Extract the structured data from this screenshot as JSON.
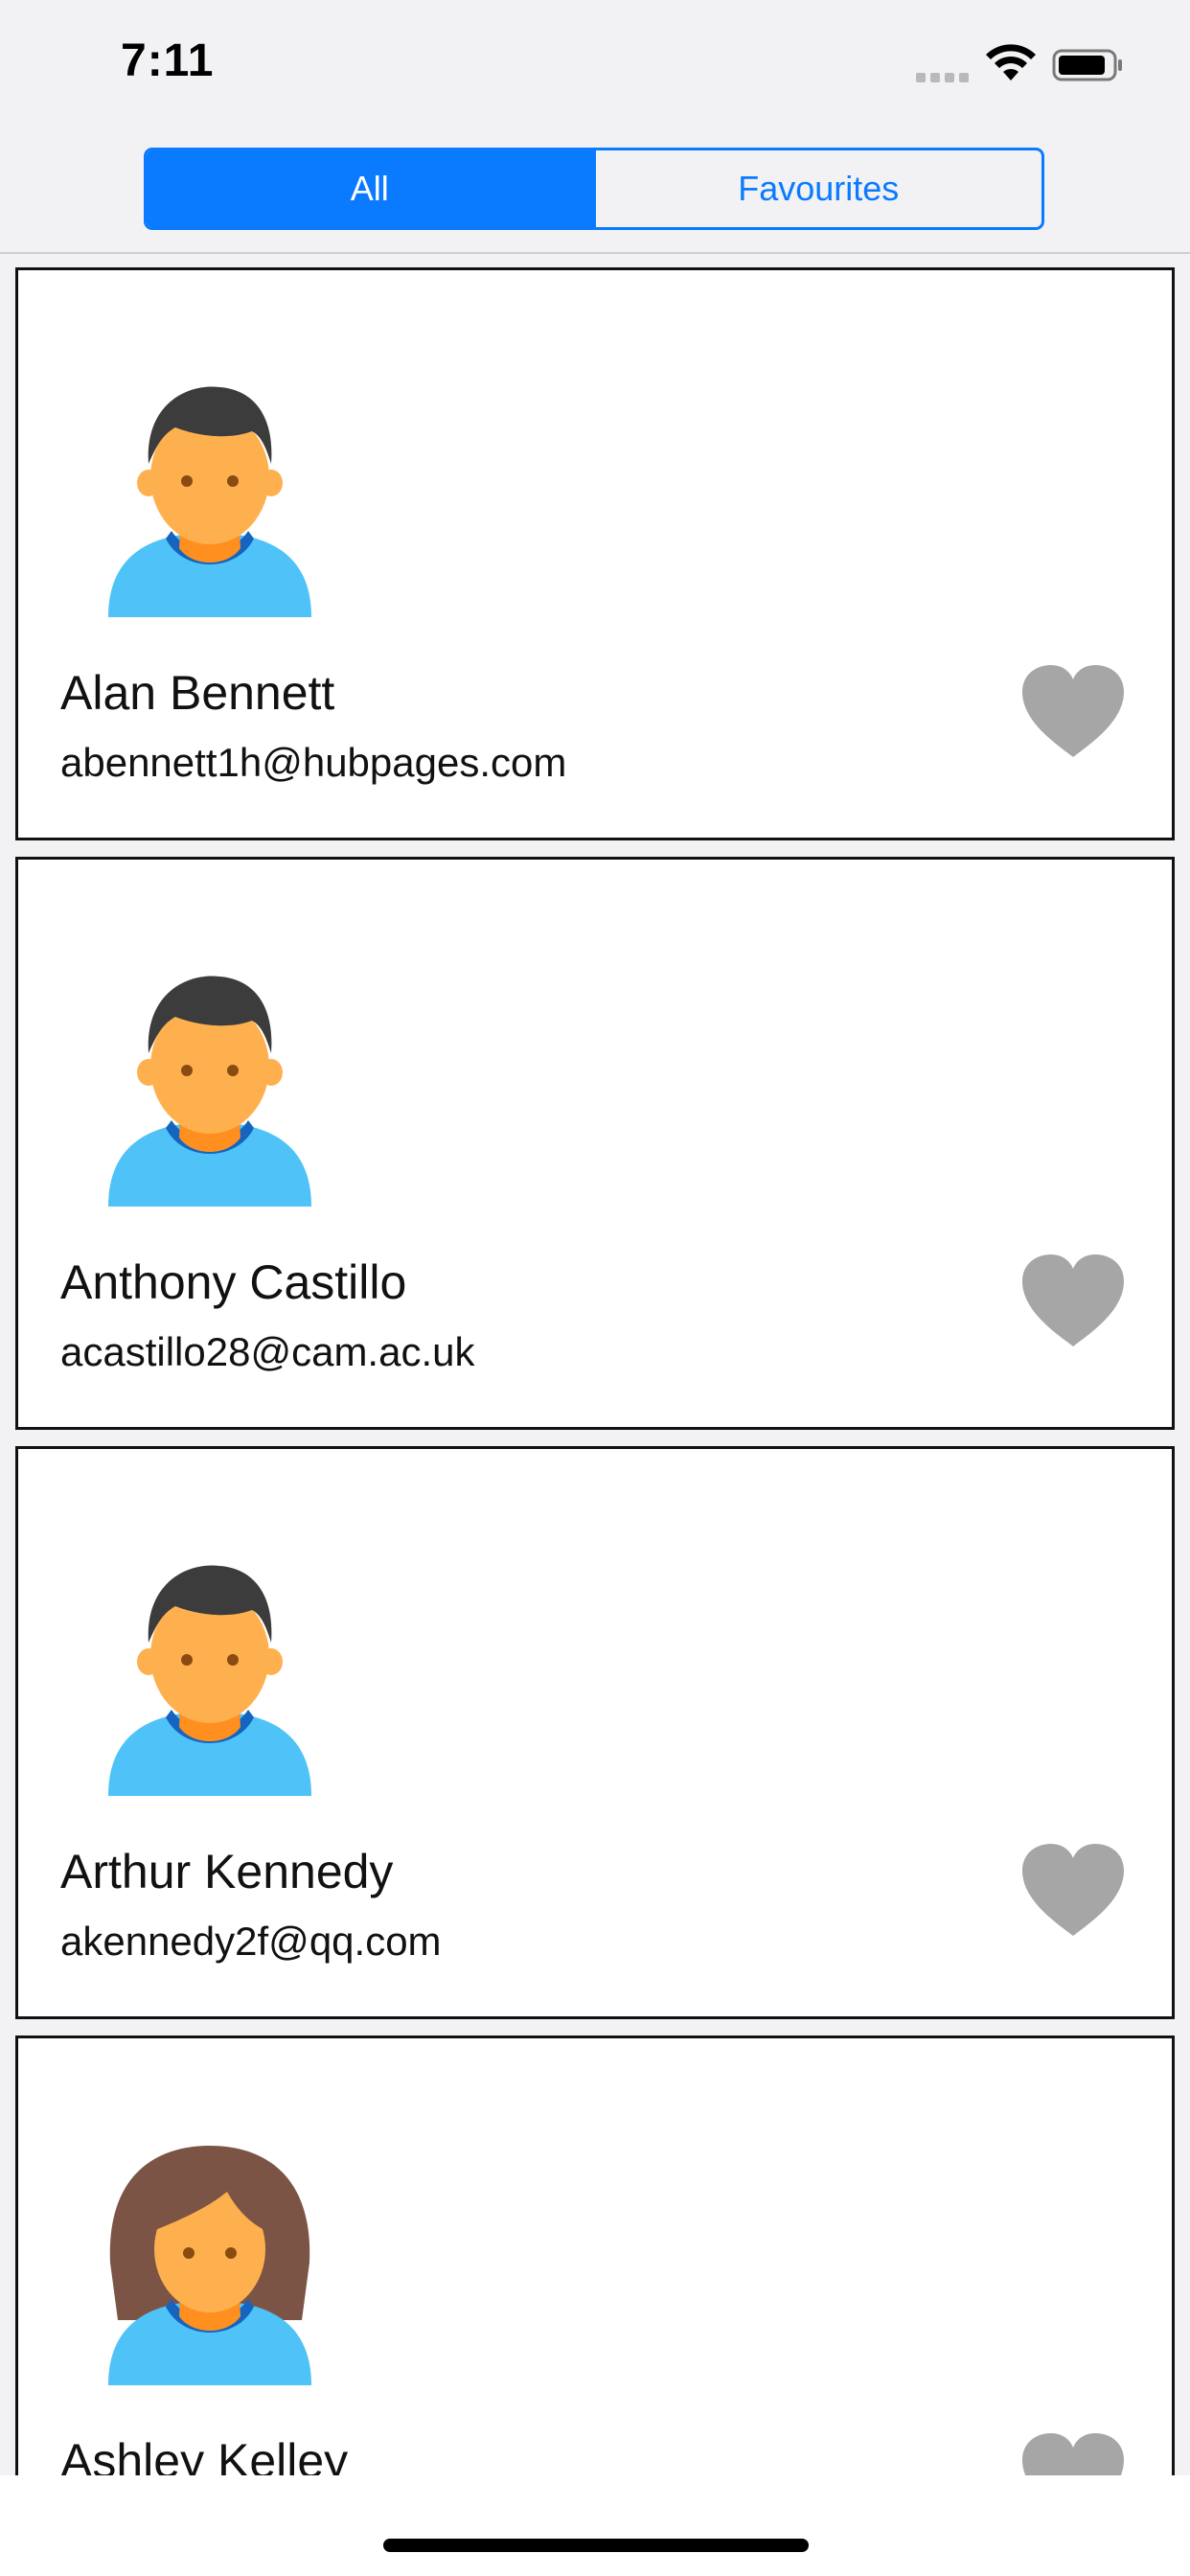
{
  "status_bar": {
    "time": "7:11"
  },
  "segmented_control": {
    "segments": [
      {
        "label": "All",
        "selected": true
      },
      {
        "label": "Favourites",
        "selected": false
      }
    ]
  },
  "colors": {
    "accent": "#0a7aff",
    "heart_inactive": "#a6a6a6",
    "skin": "#ffb04e",
    "shirt": "#4fc3f7",
    "collar": "#1565c0",
    "hair_male": "#3c3c3c",
    "hair_female": "#7b5446"
  },
  "contacts": [
    {
      "name": "Alan Bennett",
      "email": "abennett1h@hubpages.com",
      "avatar": "male-avatar-icon",
      "favourite": false
    },
    {
      "name": "Anthony Castillo",
      "email": "acastillo28@cam.ac.uk",
      "avatar": "male-avatar-icon",
      "favourite": false
    },
    {
      "name": "Arthur Kennedy",
      "email": "akennedy2f@qq.com",
      "avatar": "male-avatar-icon",
      "favourite": false
    },
    {
      "name": "Ashley Kelley",
      "email": "",
      "avatar": "female-avatar-icon",
      "favourite": false
    }
  ]
}
